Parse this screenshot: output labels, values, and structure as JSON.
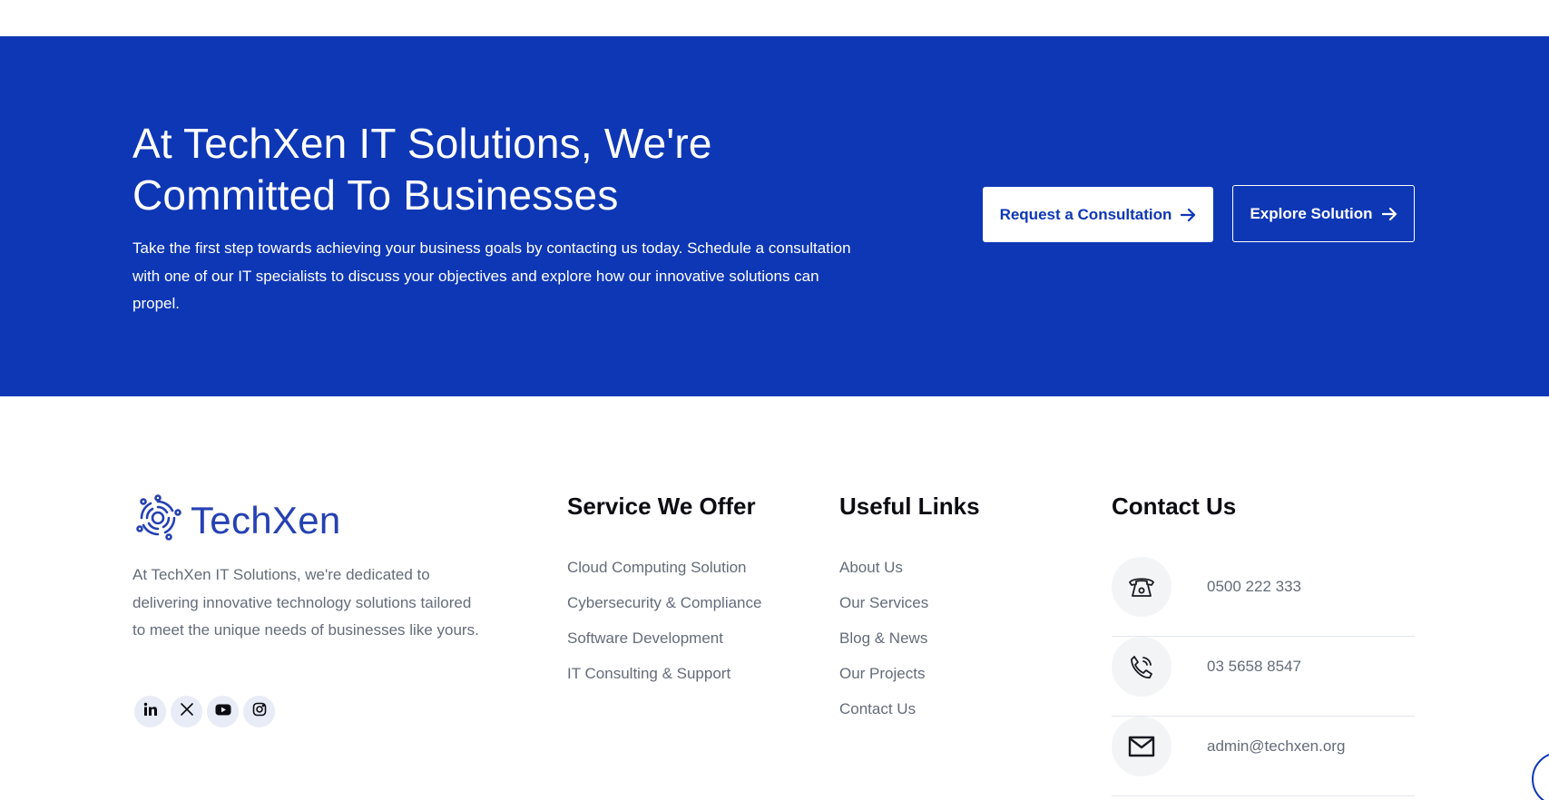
{
  "cta": {
    "title_line1": "At TechXen IT Solutions, We're",
    "title_line2": "Committed To Businesses",
    "text": "Take the first step towards achieving your business goals by contacting us today. Schedule a consultation with one of our IT specialists to discuss your objectives and explore how our innovative solutions can propel.",
    "primary_button": "Request a Consultation",
    "secondary_button": "Explore Solution"
  },
  "brand": {
    "name": "TechXen",
    "description": "At TechXen IT Solutions, we're dedicated to delivering innovative technology solutions tailored to meet the unique needs of businesses like yours."
  },
  "socials": [
    "linkedin-icon",
    "x-icon",
    "youtube-icon",
    "instagram-icon"
  ],
  "services": {
    "title": "Service We Offer",
    "items": [
      "Cloud Computing Solution",
      "Cybersecurity & Compliance",
      "Software Development",
      "IT Consulting & Support"
    ]
  },
  "useful_links": {
    "title": "Useful Links",
    "items": [
      "About Us",
      "Our Services",
      "Blog & News",
      "Our Projects",
      "Contact Us"
    ]
  },
  "contact": {
    "title": "Contact Us",
    "items": [
      {
        "icon": "telephone-icon",
        "value": "0500 222 333"
      },
      {
        "icon": "phone-call-icon",
        "value": "03 5658 8547"
      },
      {
        "icon": "envelope-icon",
        "value": "admin@techxen.org"
      }
    ]
  },
  "colors": {
    "brand_blue": "#0e37b5",
    "text_gray": "#646c7a",
    "heading": "#0b0b12"
  }
}
